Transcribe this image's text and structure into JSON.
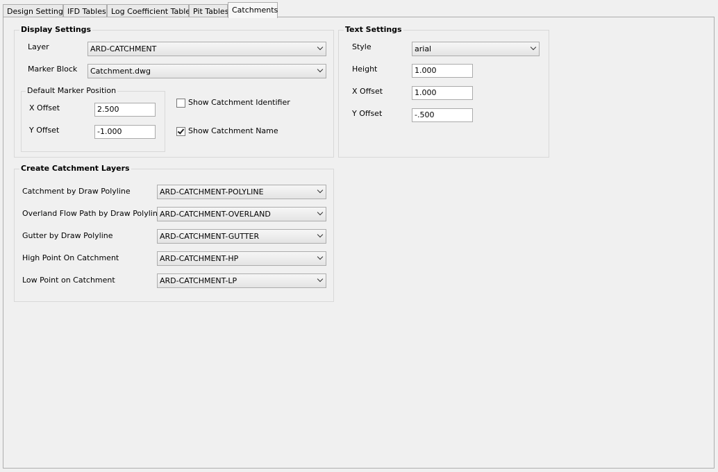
{
  "tabs": [
    {
      "label": "Design Settings"
    },
    {
      "label": "IFD Tables"
    },
    {
      "label": "Log Coefficient Tables"
    },
    {
      "label": "Pit Tables"
    },
    {
      "label": "Catchments"
    }
  ],
  "display_settings": {
    "title": "Display Settings",
    "layer_label": "Layer",
    "layer_value": "ARD-CATCHMENT",
    "marker_block_label": "Marker Block",
    "marker_block_value": "Catchment.dwg",
    "default_marker": {
      "title": "Default Marker Position",
      "x_offset_label": "X Offset",
      "x_offset_value": "2.500",
      "y_offset_label": "Y Offset",
      "y_offset_value": "-1.000"
    },
    "show_identifier_label": "Show Catchment Identifier",
    "show_identifier_checked": false,
    "show_name_label": "Show Catchment Name",
    "show_name_checked": true
  },
  "text_settings": {
    "title": "Text Settings",
    "style_label": "Style",
    "style_value": "arial",
    "height_label": "Height",
    "height_value": "1.000",
    "x_offset_label": "X Offset",
    "x_offset_value": "1.000",
    "y_offset_label": "Y Offset",
    "y_offset_value": "-.500"
  },
  "catchment_layers": {
    "title": "Create Catchment Layers",
    "rows": [
      {
        "label": "Catchment by Draw Polyline",
        "value": "ARD-CATCHMENT-POLYLINE"
      },
      {
        "label": "Overland Flow Path by Draw Polyline",
        "value": "ARD-CATCHMENT-OVERLAND"
      },
      {
        "label": "Gutter by Draw Polyline",
        "value": "ARD-CATCHMENT-GUTTER"
      },
      {
        "label": "High Point On Catchment",
        "value": "ARD-CATCHMENT-HP"
      },
      {
        "label": "Low Point on Catchment",
        "value": "ARD-CATCHMENT-LP"
      }
    ]
  }
}
